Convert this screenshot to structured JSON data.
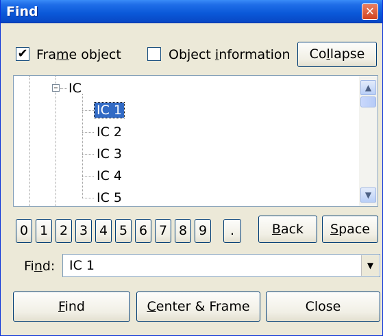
{
  "window": {
    "title": "Find",
    "close_glyph": "✕"
  },
  "options": {
    "frame_object": {
      "label_pre": "Fra",
      "label_key": "m",
      "label_post": "e object",
      "checked": true
    },
    "object_information": {
      "label_pre": "Object ",
      "label_key": "i",
      "label_post": "nformation",
      "checked": false
    },
    "collapse": {
      "label_pre": "Co",
      "label_key": "l",
      "label_post": "lapse"
    }
  },
  "tree": {
    "parent": {
      "label": "IC",
      "expand_state": "expanded"
    },
    "children": [
      "IC 1",
      "IC 2",
      "IC 3",
      "IC 4",
      "IC 5"
    ],
    "selected": "IC 1"
  },
  "keypad": {
    "keys": [
      "0",
      "1",
      "2",
      "3",
      "4",
      "5",
      "6",
      "7",
      "8",
      "9",
      "."
    ],
    "back": {
      "key": "B",
      "rest": "ack"
    },
    "space": {
      "key": "S",
      "rest": "pace"
    }
  },
  "find_field": {
    "label_pre": "Fi",
    "label_key": "n",
    "label_post": "d:",
    "value": "IC 1"
  },
  "actions": {
    "find": {
      "key": "F",
      "rest": "ind"
    },
    "center_frame": {
      "key": "C",
      "rest": "enter & Frame"
    },
    "close": "Close"
  },
  "colors": {
    "titlebar": "#0a58d8",
    "selection": "#316ac5",
    "dialog_bg": "#ece9d8"
  }
}
